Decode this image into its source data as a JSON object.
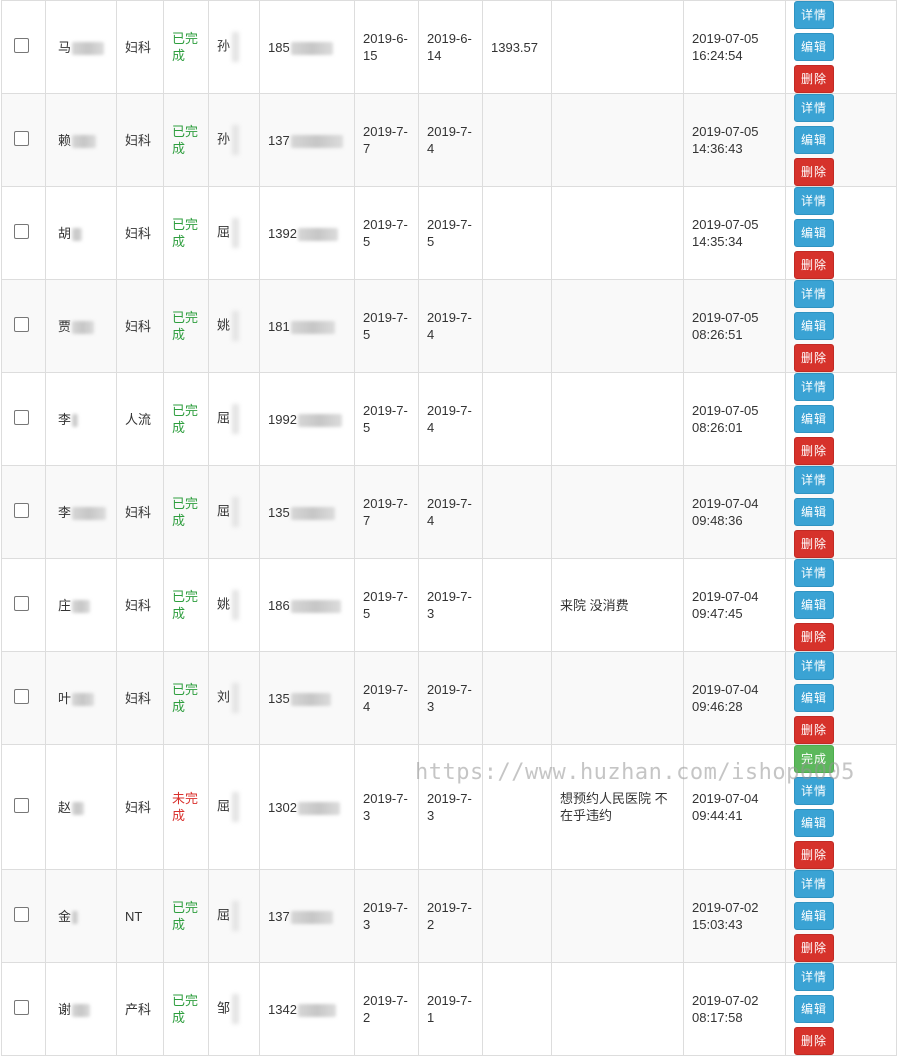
{
  "actions": {
    "detail": "详情",
    "edit": "编辑",
    "delete": "删除",
    "complete": "完成"
  },
  "rows": [
    {
      "name": "马",
      "dept": "妇科",
      "status": "已完成",
      "doctor": "孙",
      "phone": "185",
      "date1": "2019-6-15",
      "date2": "2019-6-14",
      "amount": "1393.57",
      "note": "",
      "created_date": "2019-07-05",
      "created_time": "16:24:54"
    },
    {
      "name": "赖",
      "dept": "妇科",
      "status": "已完成",
      "doctor": "孙",
      "phone": "137",
      "date1": "2019-7-7",
      "date2": "2019-7-4",
      "amount": "",
      "note": "",
      "created_date": "2019-07-05",
      "created_time": "14:36:43"
    },
    {
      "name": "胡",
      "dept": "妇科",
      "status": "已完成",
      "doctor": "屈",
      "phone": "1392",
      "date1": "2019-7-5",
      "date2": "2019-7-5",
      "amount": "",
      "note": "",
      "created_date": "2019-07-05",
      "created_time": "14:35:34"
    },
    {
      "name": "贾",
      "dept": "妇科",
      "status": "已完成",
      "doctor": "姚",
      "phone": "181",
      "date1": "2019-7-5",
      "date2": "2019-7-4",
      "amount": "",
      "note": "",
      "created_date": "2019-07-05",
      "created_time": "08:26:51"
    },
    {
      "name": "李",
      "dept": "人流",
      "status": "已完成",
      "doctor": "屈",
      "phone": "1992",
      "date1": "2019-7-5",
      "date2": "2019-7-4",
      "amount": "",
      "note": "",
      "created_date": "2019-07-05",
      "created_time": "08:26:01"
    },
    {
      "name": "李",
      "dept": "妇科",
      "status": "已完成",
      "doctor": "屈",
      "phone": "135",
      "date1": "2019-7-7",
      "date2": "2019-7-4",
      "amount": "",
      "note": "",
      "created_date": "2019-07-04",
      "created_time": "09:48:36"
    },
    {
      "name": "庄",
      "dept": "妇科",
      "status": "已完成",
      "doctor": "姚",
      "phone": "186",
      "date1": "2019-7-5",
      "date2": "2019-7-3",
      "amount": "",
      "note": "来院 没消费",
      "created_date": "2019-07-04",
      "created_time": "09:47:45"
    },
    {
      "name": "叶",
      "dept": "妇科",
      "status": "已完成",
      "doctor": "刘",
      "phone": "135",
      "date1": "2019-7-4",
      "date2": "2019-7-3",
      "amount": "",
      "note": "",
      "created_date": "2019-07-04",
      "created_time": "09:46:28"
    },
    {
      "name": "赵",
      "dept": "妇科",
      "status": "未完成",
      "doctor": "屈",
      "phone": "1302",
      "date1": "2019-7-3",
      "date2": "2019-7-3",
      "amount": "",
      "note": "想预约人民医院 不在乎违约",
      "created_date": "2019-07-04",
      "created_time": "09:44:41"
    },
    {
      "name": "金",
      "dept": "NT",
      "status": "已完成",
      "doctor": "屈",
      "phone": "137",
      "date1": "2019-7-3",
      "date2": "2019-7-2",
      "amount": "",
      "note": "",
      "created_date": "2019-07-02",
      "created_time": "15:03:43"
    },
    {
      "name": "谢",
      "dept": "产科",
      "status": "已完成",
      "doctor": "邹",
      "phone": "1342",
      "date1": "2019-7-2",
      "date2": "2019-7-1",
      "amount": "",
      "note": "",
      "created_date": "2019-07-02",
      "created_time": "08:17:58"
    }
  ],
  "watermark": "https://www.huzhan.com/ishop6005"
}
